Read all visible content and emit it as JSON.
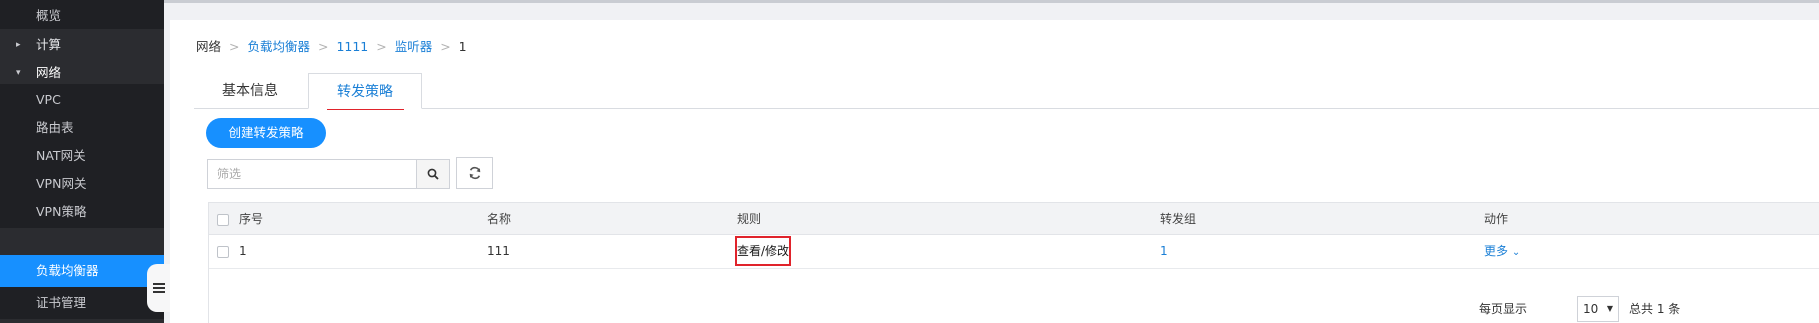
{
  "sidebar": {
    "items": [
      {
        "label": "概览"
      },
      {
        "label": "计算"
      },
      {
        "label": "网络"
      },
      {
        "label": "VPC"
      },
      {
        "label": "路由表"
      },
      {
        "label": "NAT网关"
      },
      {
        "label": "VPN网关"
      },
      {
        "label": "VPN策略"
      },
      {
        "label": "负载均衡器"
      },
      {
        "label": "证书管理"
      }
    ],
    "active": "负载均衡器"
  },
  "breadcrumb": {
    "root": "网络",
    "items": [
      "负载均衡器",
      "1111",
      "监听器"
    ],
    "current": "1",
    "separator": ">"
  },
  "tabs": [
    {
      "label": "基本信息"
    },
    {
      "label": "转发策略"
    }
  ],
  "toolbar": {
    "create_label": "创建转发策略",
    "filter_placeholder": "筛选",
    "search_icon": "search-icon",
    "refresh_icon": "refresh-icon"
  },
  "table": {
    "columns": [
      "序号",
      "名称",
      "规则",
      "转发组",
      "动作"
    ],
    "rows": [
      {
        "index": "1",
        "name": "111",
        "rule": "查看/修改",
        "group": "1",
        "action": "更多"
      }
    ]
  },
  "pagination": {
    "per_page_label": "每页显示",
    "per_page_value": "10",
    "total_label": "总共 1 条"
  },
  "colors": {
    "accent": "#1790ff",
    "sidebar_bg": "#2b2c30",
    "highlight_box": "#e0232b"
  }
}
